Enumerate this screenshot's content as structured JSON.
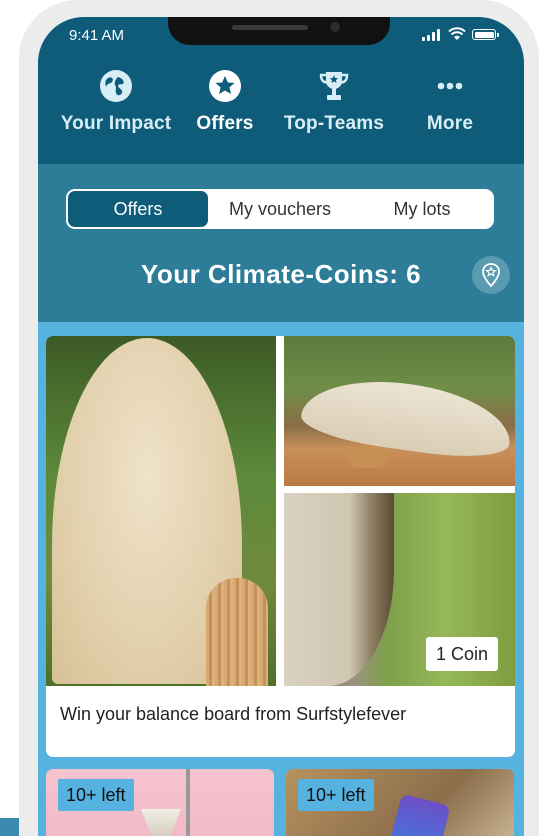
{
  "status_bar": {
    "time": "9:41 AM"
  },
  "nav": {
    "items": [
      {
        "label": "Your Impact",
        "icon": "globe-icon",
        "active": false
      },
      {
        "label": "Offers",
        "icon": "star-icon",
        "active": true
      },
      {
        "label": "Top-Teams",
        "icon": "trophy-icon",
        "active": false
      },
      {
        "label": "More",
        "icon": "more-dots-icon",
        "active": false
      }
    ]
  },
  "segmented": {
    "tabs": [
      "Offers",
      "My vouchers",
      "My lots"
    ],
    "active_index": 0
  },
  "coins": {
    "text": "Your Climate-Coins: 6"
  },
  "offers": [
    {
      "title": "Win your balance board from Surfstylefever",
      "price_badge": "1 Coin"
    },
    {
      "stock_badge": "10+ left"
    },
    {
      "stock_badge": "10+ left"
    }
  ],
  "colors": {
    "nav_bg": "#0e5c7a",
    "header_bg": "#2d7d98",
    "content_bg": "#56b3e0",
    "accent": "#56b3e0"
  }
}
